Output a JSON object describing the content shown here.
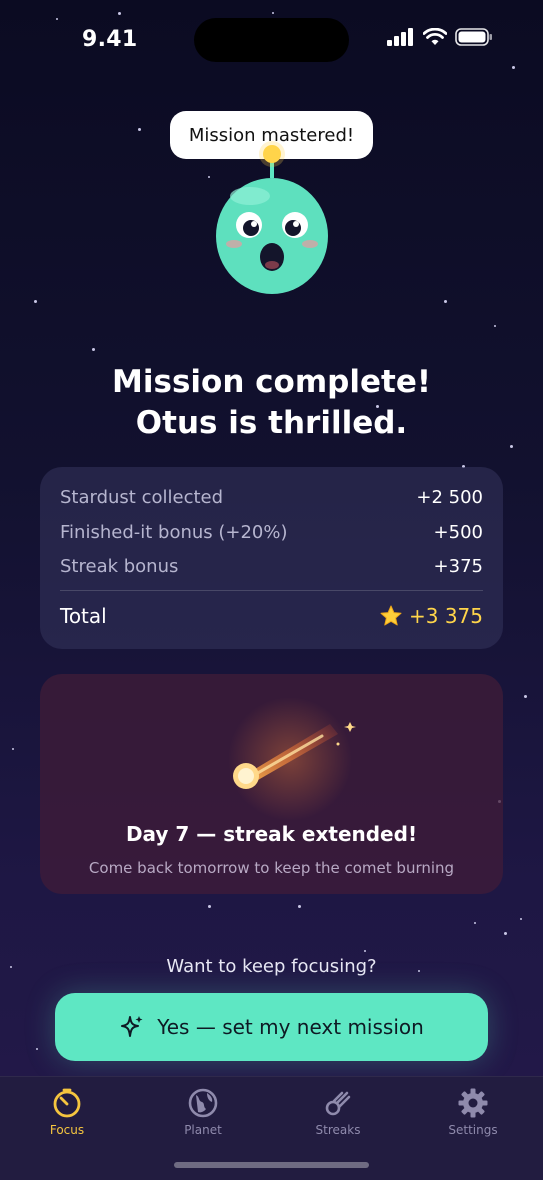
{
  "status_bar": {
    "time": "9.41"
  },
  "mascot": {
    "speech": "Mission mastered!"
  },
  "headline": {
    "line1": "Mission complete!",
    "line2": "Otus is thrilled."
  },
  "summary": {
    "rows": [
      {
        "label": "Stardust collected",
        "value": "+2 500"
      },
      {
        "label": "Finished-it bonus (+20%)",
        "value": "+500"
      },
      {
        "label": "Streak bonus",
        "value": "+375"
      }
    ],
    "total_label": "Total",
    "total_value": "+3 375"
  },
  "streak": {
    "title": "Day 7 — streak extended!",
    "subtitle": "Come back tomorrow to keep the comet burning"
  },
  "prompt": "Want to keep focusing?",
  "cta_label": "Yes — set my next mission",
  "tabs": [
    {
      "label": "Focus",
      "icon": "timer-icon",
      "active": true
    },
    {
      "label": "Planet",
      "icon": "globe-icon",
      "active": false
    },
    {
      "label": "Streaks",
      "icon": "comet-icon",
      "active": false
    },
    {
      "label": "Settings",
      "icon": "gear-icon",
      "active": false
    }
  ],
  "colors": {
    "accent": "#5ee7c3",
    "gold": "#ffd54a",
    "active_tab": "#f5c53f"
  }
}
